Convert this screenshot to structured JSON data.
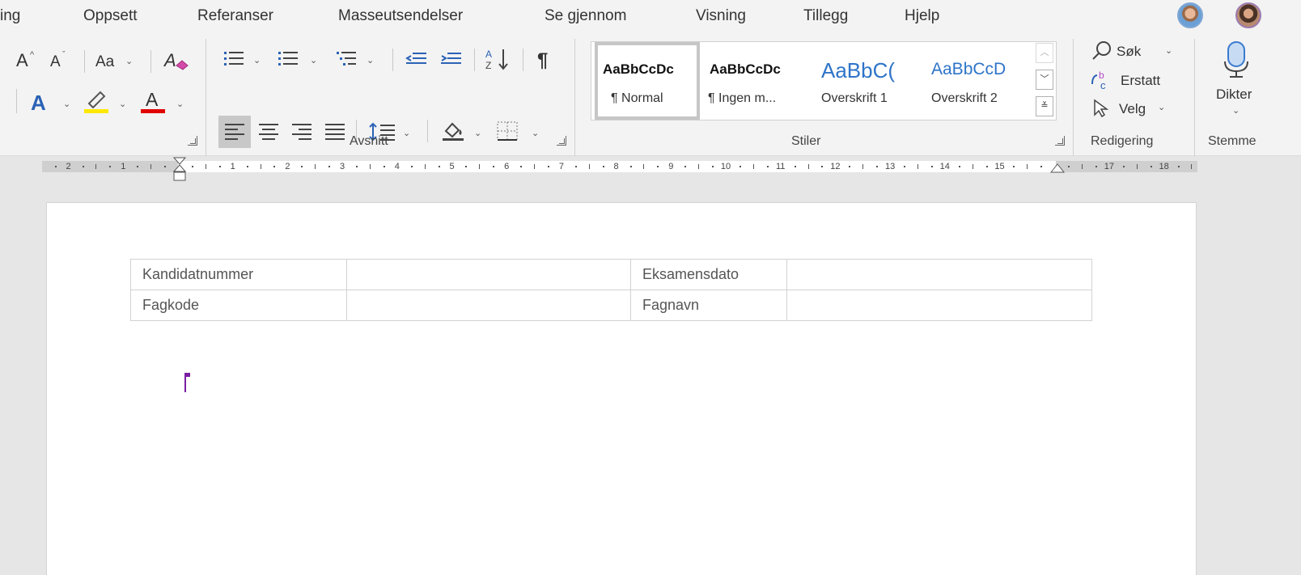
{
  "menu": {
    "tabs": [
      "ing",
      "Oppsett",
      "Referanser",
      "Masseutsendelser",
      "Se gjennom",
      "Visning",
      "Tillegg",
      "Hjelp"
    ]
  },
  "ribbon": {
    "font": {
      "grow_label": "A",
      "shrink_label": "A",
      "case_label": "Aa",
      "clear_label": "A",
      "effects_label": "A",
      "font_color_label": "A"
    },
    "paragraph": {
      "group_label": "Avsnitt",
      "pilcrow": "¶"
    },
    "styles": {
      "group_label": "Stiler",
      "items": [
        {
          "preview": "AaBbCcDc",
          "name": "¶ Normal"
        },
        {
          "preview": "AaBbCcDc",
          "name": "¶ Ingen m..."
        },
        {
          "preview": "AaBbC(",
          "name": "Overskrift 1"
        },
        {
          "preview": "AaBbCcD",
          "name": "Overskrift 2"
        }
      ]
    },
    "editing": {
      "group_label": "Redigering",
      "search_label": "Søk",
      "replace_label": "Erstatt",
      "select_label": "Velg"
    },
    "voice": {
      "group_label": "Stemme",
      "dictate_label": "Dikter"
    }
  },
  "ruler": {
    "labels": [
      "2",
      "1",
      "1",
      "2",
      "3",
      "4",
      "5",
      "6",
      "7",
      "8",
      "9",
      "10",
      "11",
      "12",
      "13",
      "14",
      "15",
      "17",
      "18"
    ]
  },
  "document": {
    "table": [
      [
        "Kandidatnummer",
        "",
        "Eksamensdato",
        ""
      ],
      [
        "Fagkode",
        "",
        "Fagnavn",
        ""
      ]
    ]
  },
  "colors": {
    "highlight": "#ffe800",
    "font_color": "#e00000",
    "accent": "#2b62b5",
    "cursor": "#7a1fa2"
  }
}
